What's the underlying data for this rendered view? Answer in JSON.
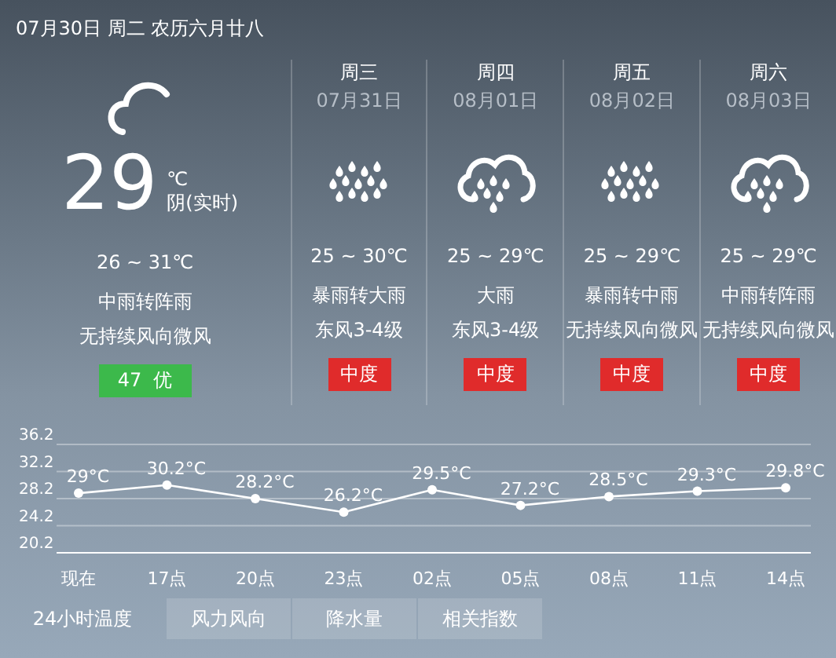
{
  "header": "07月30日 周二 农历六月廿八",
  "today": {
    "kind": "cloudy",
    "temperature": "29",
    "unit": "℃",
    "condition": "阴(实时)",
    "range": "26 ~ 31℃",
    "weather": "中雨转阵雨",
    "wind": "无持续风向微风",
    "aqi": {
      "label": "47  优",
      "color": "#3cb94b"
    }
  },
  "days": [
    {
      "day": "周三",
      "date": "07月31日",
      "kind": "showers",
      "range": "25 ~ 30℃",
      "weather": "暴雨转大雨",
      "wind": "东风3-4级",
      "aqi": {
        "label": "中度",
        "color": "#e02b2b"
      }
    },
    {
      "day": "周四",
      "date": "08月01日",
      "kind": "cloud-rain",
      "range": "25 ~ 29℃",
      "weather": "大雨",
      "wind": "东风3-4级",
      "aqi": {
        "label": "中度",
        "color": "#e02b2b"
      }
    },
    {
      "day": "周五",
      "date": "08月02日",
      "kind": "showers",
      "range": "25 ~ 29℃",
      "weather": "暴雨转中雨",
      "wind": "无持续风向微风",
      "aqi": {
        "label": "中度",
        "color": "#e02b2b"
      }
    },
    {
      "day": "周六",
      "date": "08月03日",
      "kind": "cloud-rain",
      "range": "25 ~ 29℃",
      "weather": "中雨转阵雨",
      "wind": "无持续风向微风",
      "aqi": {
        "label": "中度",
        "color": "#e02b2b"
      }
    }
  ],
  "chart_data": {
    "type": "line",
    "categories": [
      "现在",
      "17点",
      "20点",
      "23点",
      "02点",
      "05点",
      "08点",
      "11点",
      "14点"
    ],
    "series": [
      {
        "color": "#ffffff",
        "marker": "circle",
        "values": [
          29,
          30.2,
          28.2,
          26.2,
          29.5,
          27.2,
          28.5,
          29.3,
          29.8
        ]
      }
    ],
    "value_labels": [
      "29°C",
      "30.2°C",
      "28.2°C",
      "26.2°C",
      "29.5°C",
      "27.2°C",
      "28.5°C",
      "29.3°C",
      "29.8°C"
    ],
    "grid": true,
    "ylim": [
      20.2,
      36.2
    ],
    "yticks": [
      36.2,
      32.2,
      28.2,
      24.2,
      20.2
    ]
  },
  "tabs": [
    {
      "label": "24小时温度",
      "selected": true
    },
    {
      "label": "风力风向",
      "selected": false
    },
    {
      "label": "降水量",
      "selected": false
    },
    {
      "label": "相关指数",
      "selected": false
    }
  ]
}
